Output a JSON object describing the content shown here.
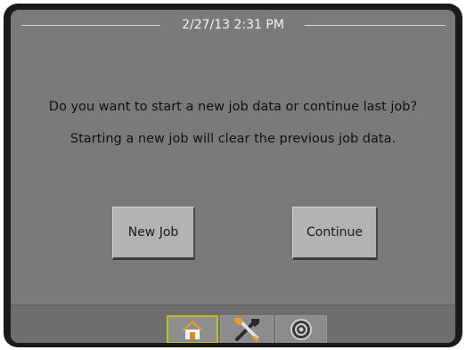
{
  "header": {
    "datetime": "2/27/13 2:31 PM"
  },
  "dialog": {
    "question": "Do you want to start a new job data or continue last job?",
    "warning": "Starting a new job will clear the previous job data."
  },
  "buttons": {
    "new_job": "New Job",
    "continue": "Continue"
  },
  "tabs": [
    {
      "icon": "home-icon",
      "selected": true
    },
    {
      "icon": "tools-icon",
      "selected": false
    },
    {
      "icon": "gauge-icon",
      "selected": false
    }
  ],
  "colors": {
    "screen_bg": "#7a7a7a",
    "selected_tab_border": "#b9c41e",
    "home_roof": "#e8a020"
  }
}
